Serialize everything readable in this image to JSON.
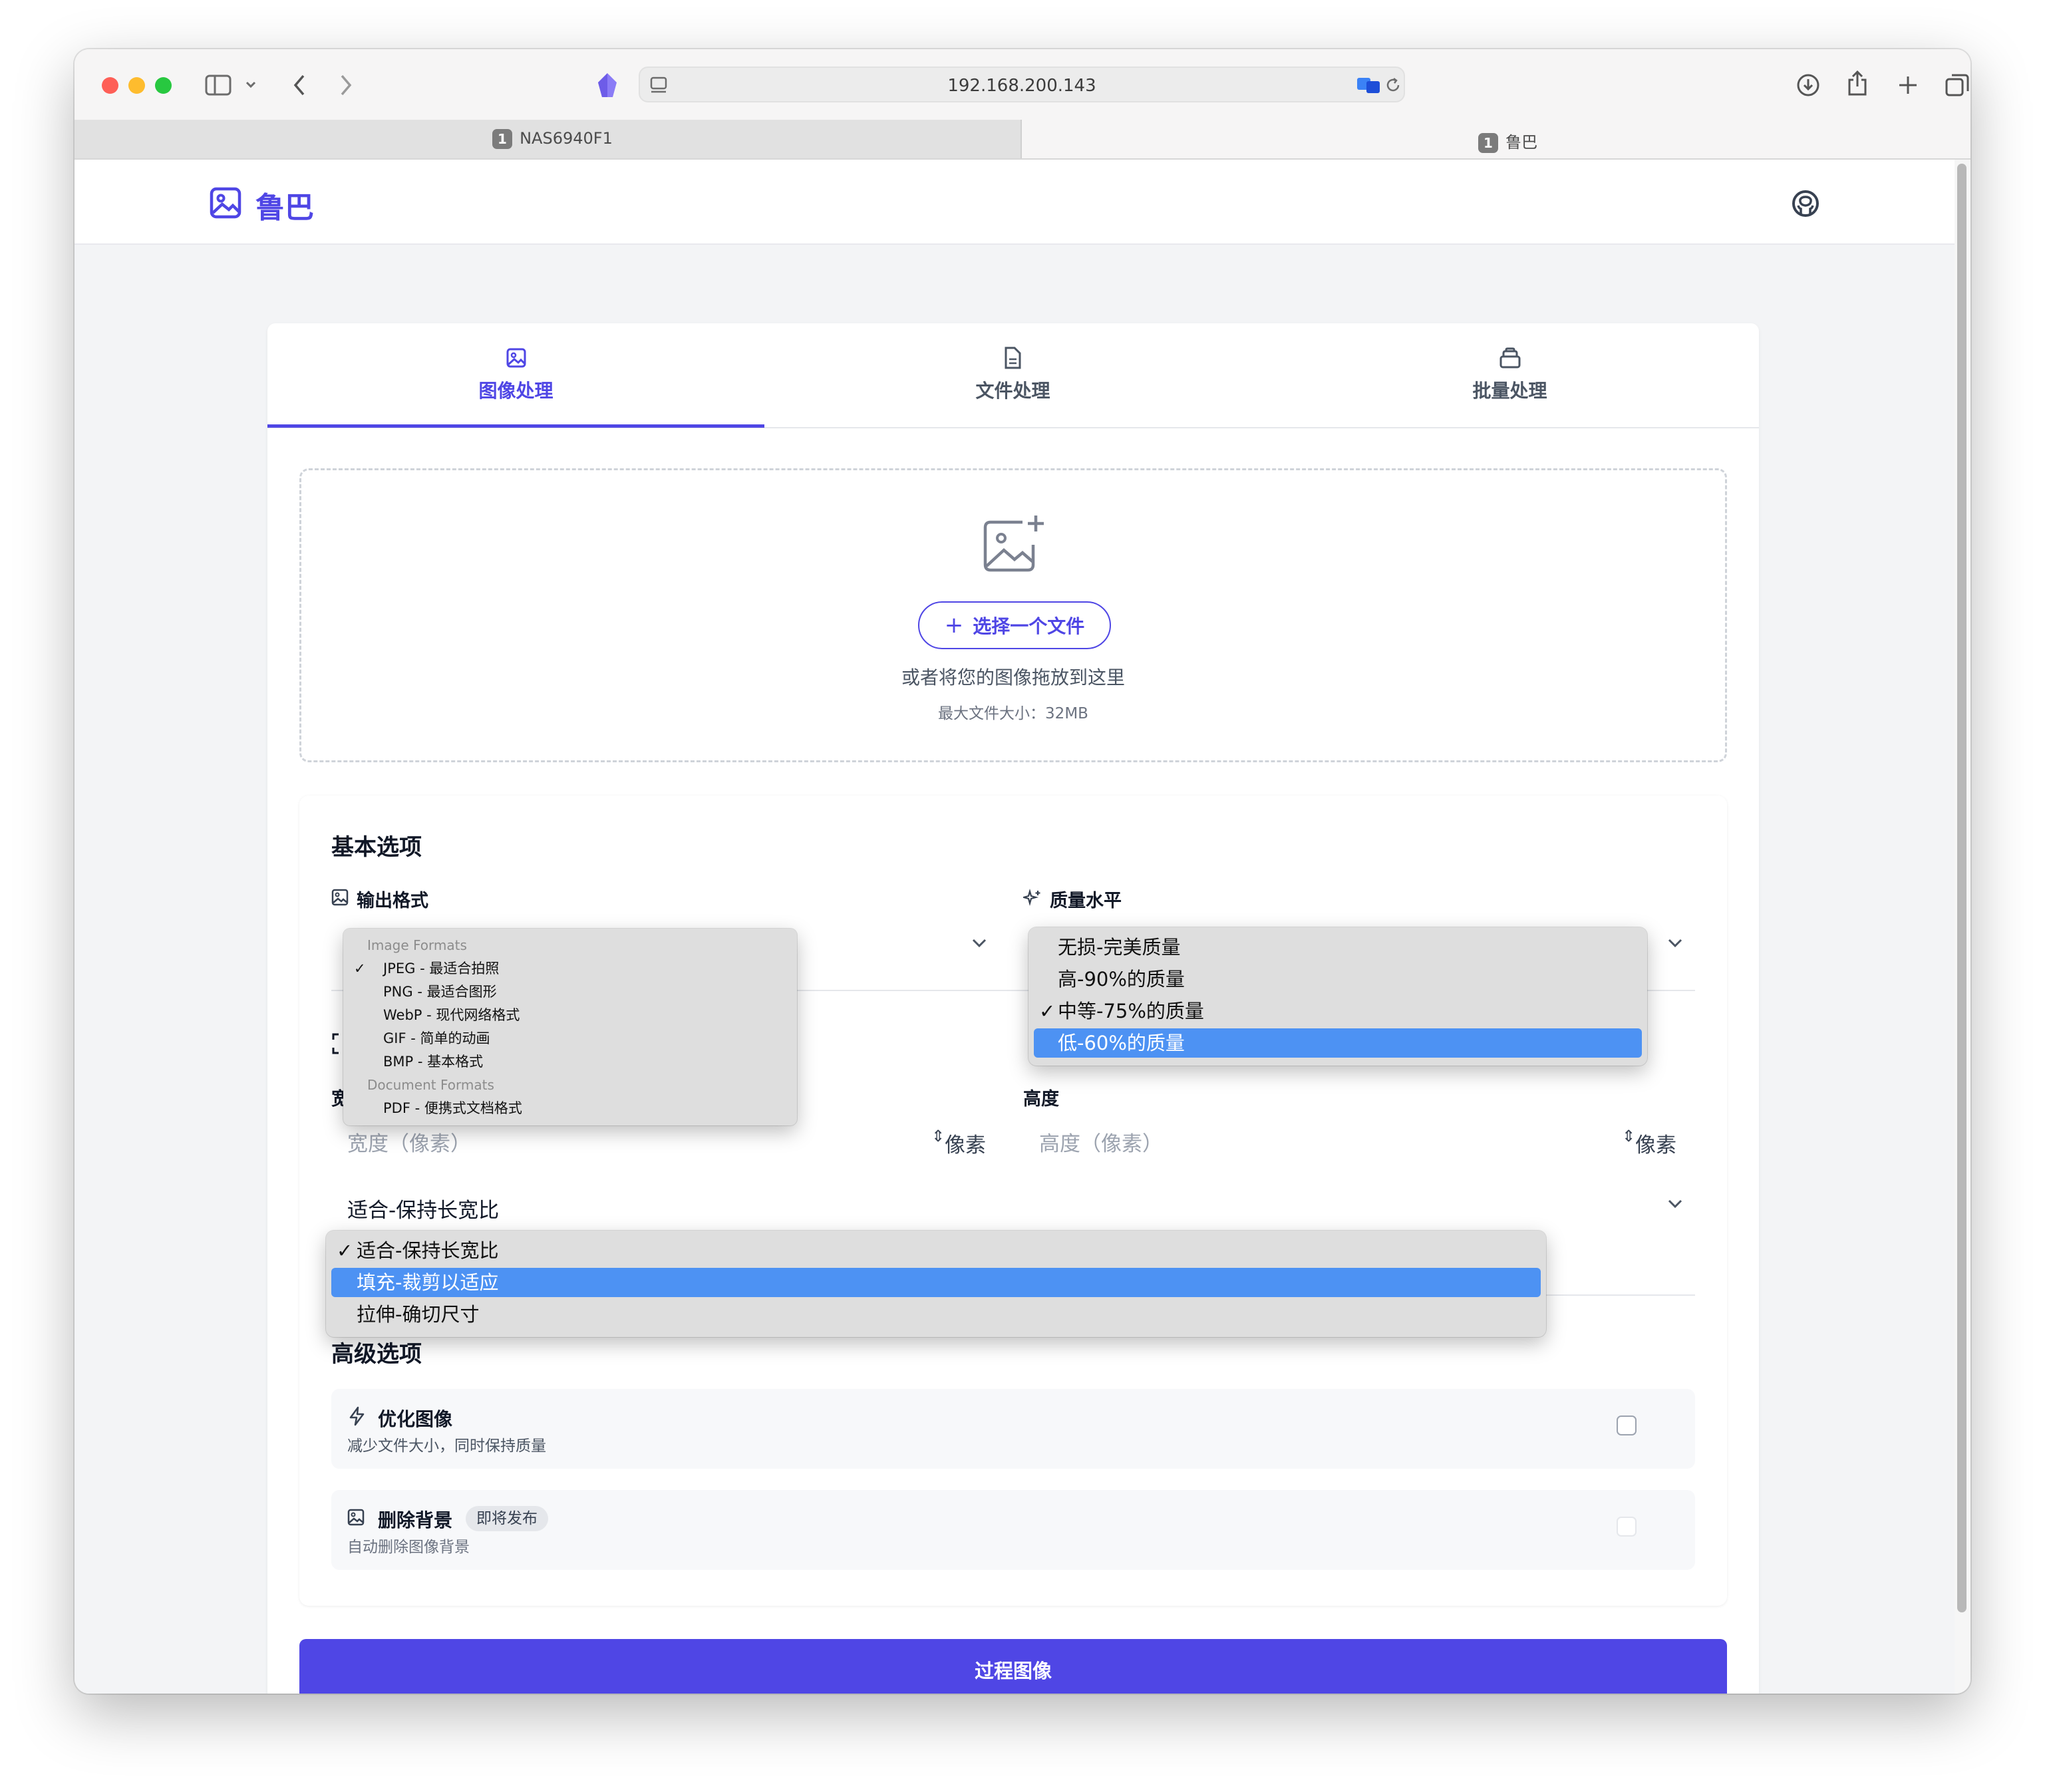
{
  "browser": {
    "url": "192.168.200.143",
    "tabs": [
      {
        "number": "1",
        "title": "NAS6940F1",
        "active": true
      },
      {
        "number": "1",
        "title": "鲁巴",
        "active": false
      }
    ],
    "tab_close_glyph": "×"
  },
  "header": {
    "brand": "鲁巴",
    "logo_icon": "image-icon",
    "github_icon": "github-icon"
  },
  "tabs": [
    {
      "label": "图像处理",
      "icon": "image-icon",
      "active": true
    },
    {
      "label": "文件处理",
      "icon": "file-icon",
      "active": false
    },
    {
      "label": "批量处理",
      "icon": "layers-icon",
      "active": false
    }
  ],
  "upload": {
    "button_label": "选择一个文件",
    "hint": "或者将您的图像拖放到这里",
    "max_size": "最大文件大小：32MB"
  },
  "basic": {
    "title": "基本选项",
    "output_format_label": "输出格式",
    "quality_label": "质量水平",
    "height_label": "高度",
    "width_label_partial": "宽",
    "width_placeholder": "宽度（像素）",
    "height_placeholder": "高度（像素）",
    "unit": "像素",
    "resize_mode_value": "适合-保持长宽比"
  },
  "format_popup": {
    "groups": [
      {
        "label": "Image Formats",
        "options": [
          {
            "label": "JPEG - 最适合拍照",
            "checked": true
          },
          {
            "label": "PNG - 最适合图形",
            "checked": false
          },
          {
            "label": "WebP - 现代网络格式",
            "checked": false
          },
          {
            "label": "GIF - 简单的动画",
            "checked": false
          },
          {
            "label": "BMP - 基本格式",
            "checked": false
          }
        ]
      },
      {
        "label": "Document Formats",
        "options": [
          {
            "label": "PDF - 便携式文档格式",
            "checked": false
          }
        ]
      }
    ]
  },
  "quality_popup": {
    "options": [
      {
        "label": "无损-完美质量",
        "checked": false,
        "highlighted": false
      },
      {
        "label": "高-90%的质量",
        "checked": false,
        "highlighted": false
      },
      {
        "label": "中等-75%的质量",
        "checked": true,
        "highlighted": false
      },
      {
        "label": "低-60%的质量",
        "checked": false,
        "highlighted": true
      }
    ]
  },
  "resize_popup": {
    "options": [
      {
        "label": "适合-保持长宽比",
        "checked": true,
        "highlighted": false
      },
      {
        "label": "填充-裁剪以适应",
        "checked": false,
        "highlighted": true
      },
      {
        "label": "拉伸-确切尺寸",
        "checked": false,
        "highlighted": false
      }
    ]
  },
  "advanced": {
    "title": "高级选项",
    "optimize": {
      "title": "优化图像",
      "desc": "减少文件大小，同时保持质量",
      "checked": false
    },
    "remove_bg": {
      "title": "删除背景",
      "badge": "即将发布",
      "desc": "自动删除图像背景",
      "checked": false,
      "disabled": true
    }
  },
  "process_button": "过程图像",
  "colors": {
    "accent": "#4f46e5",
    "highlight": "#4d92f3",
    "page_bg": "#f3f4f6"
  },
  "check_glyph": "✓"
}
